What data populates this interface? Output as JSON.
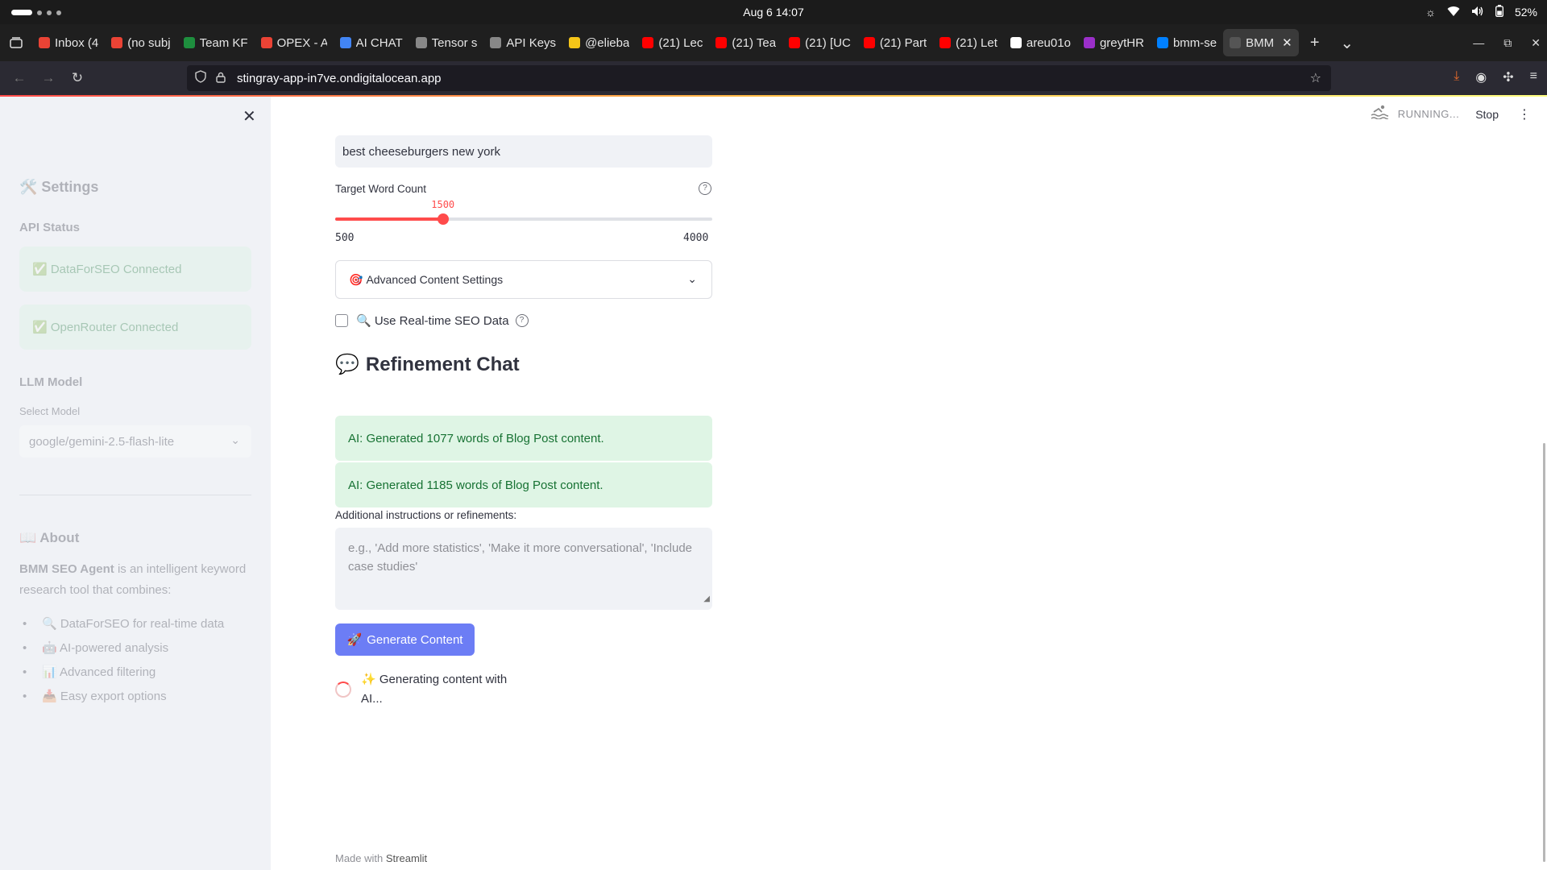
{
  "os": {
    "clock": "Aug 6  14:07",
    "battery": "52%",
    "icons": [
      "brightness-icon",
      "wifi-icon",
      "volume-icon",
      "battery-icon"
    ]
  },
  "tabs": [
    {
      "label": "Inbox (4",
      "icon": "gmail-icon",
      "color": "#ea4335"
    },
    {
      "label": "(no subj",
      "icon": "gmail-icon",
      "color": "#ea4335"
    },
    {
      "label": "Team KF",
      "icon": "sheets-icon",
      "color": "#1e8e3e"
    },
    {
      "label": "OPEX - A",
      "icon": "google-icon",
      "color": "#ea4335"
    },
    {
      "label": "AI CHAT",
      "icon": "docs-icon",
      "color": "#4285f4"
    },
    {
      "label": "Tensor s",
      "icon": "gear-icon",
      "color": "#888888"
    },
    {
      "label": "API Keys",
      "icon": "api-icon",
      "color": "#888888"
    },
    {
      "label": "@elieba",
      "icon": "emoji-icon",
      "color": "#f5c518"
    },
    {
      "label": "(21) Lec",
      "icon": "youtube-icon",
      "color": "#ff0000"
    },
    {
      "label": "(21) Tea",
      "icon": "youtube-icon",
      "color": "#ff0000"
    },
    {
      "label": "(21) [UC",
      "icon": "youtube-icon",
      "color": "#ff0000"
    },
    {
      "label": "(21) Part",
      "icon": "youtube-icon",
      "color": "#ff0000"
    },
    {
      "label": "(21) Let",
      "icon": "youtube-icon",
      "color": "#ff0000"
    },
    {
      "label": "areu01o",
      "icon": "github-icon",
      "color": "#ffffff"
    },
    {
      "label": "greytHR",
      "icon": "greythr-icon",
      "color": "#9b2fc9"
    },
    {
      "label": "bmm-se",
      "icon": "digitalocean-icon",
      "color": "#0080ff"
    },
    {
      "label": "BMM",
      "icon": "search-icon",
      "color": "#555555",
      "active": true
    }
  ],
  "browser": {
    "url": "stingray-app-in7ve.ondigitalocean.app"
  },
  "sidebar": {
    "close_label": "✕",
    "settings_title": "🛠️ Settings",
    "api_status_title": "API Status",
    "status_messages": [
      "✅ DataForSEO Connected",
      "✅ OpenRouter Connected"
    ],
    "llm_title": "LLM Model",
    "select_label": "Select Model",
    "select_value": "google/gemini-2.5-flash-lite",
    "about_title": "📖 About",
    "about_bold": "BMM SEO Agent",
    "about_rest": " is an intelligent keyword research tool that combines:",
    "features": [
      "🔍 DataForSEO for real-time data",
      "🤖 AI-powered analysis",
      "📊 Advanced filtering",
      "📥 Easy export options"
    ]
  },
  "main": {
    "status": "RUNNING...",
    "stop_label": "Stop",
    "keyword_value": "best cheeseburgers new york",
    "word_count_label": "Target Word Count",
    "slider": {
      "value": 1500,
      "min": 500,
      "max": 4000
    },
    "slider_value_text": "1500",
    "slider_min_text": "500",
    "slider_max_text": "4000",
    "expander_label": "Advanced Content Settings",
    "checkbox_label": "🔍 Use Real-time SEO Data",
    "checkbox_checked": false,
    "chat_title": "Refinement Chat",
    "chat_messages": [
      "AI: Generated 1077 words of Blog Post content.",
      "AI: Generated 1185 words of Blog Post content."
    ],
    "textarea_label": "Additional instructions or refinements:",
    "textarea_placeholder": "e.g., 'Add more statistics', 'Make it more conversational', 'Include case studies'",
    "generate_label": "Generate Content",
    "spinner_text": "✨ Generating content with AI...",
    "footer_prefix": "Made with ",
    "footer_brand": "Streamlit"
  },
  "colors": {
    "accent": "#ff4b4b",
    "button": "#6c7df5",
    "success_bg": "#dff5e5",
    "success_text": "#177233"
  }
}
